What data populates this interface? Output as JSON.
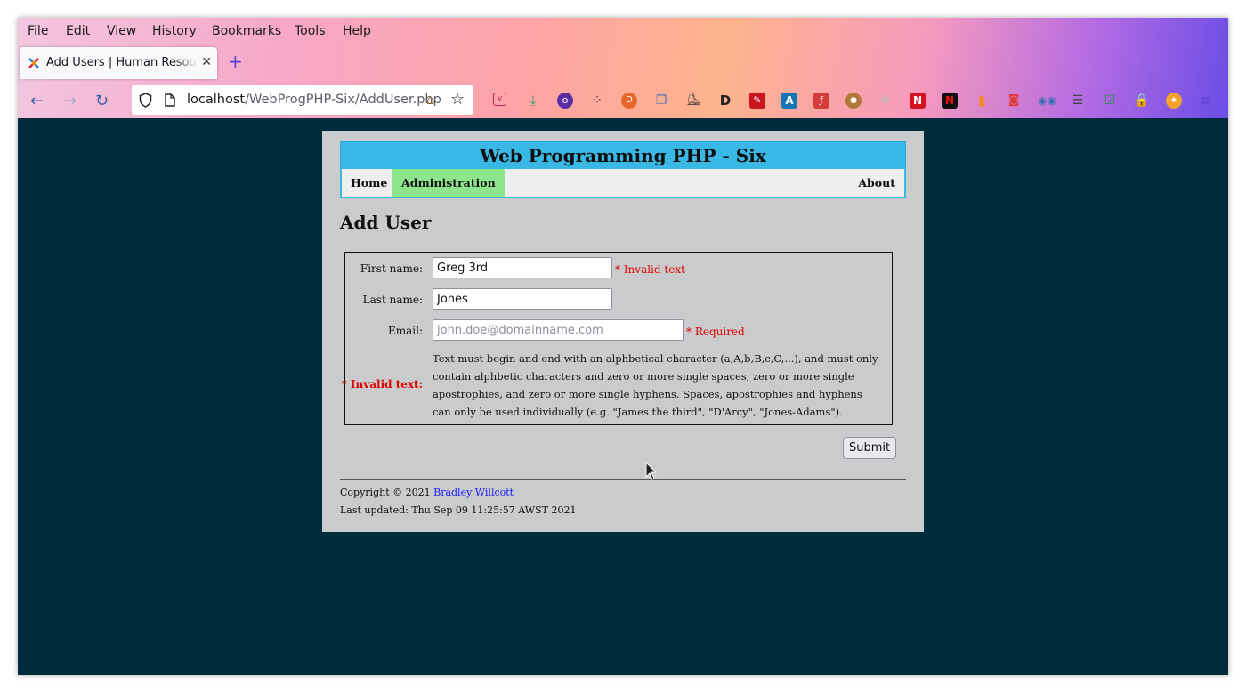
{
  "browser": {
    "menu": [
      "File",
      "Edit",
      "View",
      "History",
      "Bookmarks",
      "Tools",
      "Help"
    ],
    "tab": {
      "title": "Add Users | Human Resources",
      "close_glyph": "✕"
    },
    "new_tab_glyph": "+",
    "url": {
      "host": "localhost",
      "path": "/WebProgPHP-Six/AddUser.php"
    },
    "extensions": [
      "pocket-icon",
      "download-icon",
      "privacy-badger-icon",
      "dots-icon",
      "duckduckgo-icon",
      "tabs-icon",
      "shoe-icon",
      "disqus-icon",
      "ruler-icon",
      "translate-a-icon",
      "pdf-icon",
      "cookie-icon",
      "leaf-icon",
      "netflix-icon",
      "netflix-alt-icon",
      "trash-icon",
      "camera-icon",
      "eyes-icon",
      "server-icon",
      "bookmark-check-icon",
      "lock-icon",
      "firebug-icon",
      "hamburger-menu-icon"
    ]
  },
  "site": {
    "title": "Web Programming PHP - Six",
    "nav": {
      "home": "Home",
      "administration": "Administration",
      "about": "About"
    }
  },
  "page": {
    "heading": "Add User",
    "form": {
      "first_name": {
        "label": "First name:",
        "value": "Greg 3rd",
        "error": "* Invalid text"
      },
      "last_name": {
        "label": "Last name:",
        "value": "Jones"
      },
      "email": {
        "label": "Email:",
        "value": "",
        "placeholder": "john.doe@domainname.com",
        "error": "* Required"
      },
      "invalid_label": "* Invalid text:",
      "invalid_help": "Text must begin and end with an alphbetical character (a,A,b,B,c,C,...), and must only contain alphbetic characters and zero or more single spaces, zero or more single apostrophies, and zero or more single hyphens. Spaces, apostrophies and hyphens can only be used individually (e.g. \"James the third\", \"D'Arcy\", \"Jones-Adams\").",
      "submit_label": "Submit"
    }
  },
  "footer": {
    "copyright_prefix": "Copyright © 2021",
    "author": "Bradley Willcott",
    "last_updated": "Last updated: Thu Sep 09 11:25:57 AWST 2021"
  },
  "colors": {
    "page_bg": "#002b3c",
    "content_bg": "#c9cbcc",
    "header_bg": "#39b7e5",
    "nav_active": "#8ee68c",
    "error": "#e00000",
    "link": "#1a1aff"
  }
}
